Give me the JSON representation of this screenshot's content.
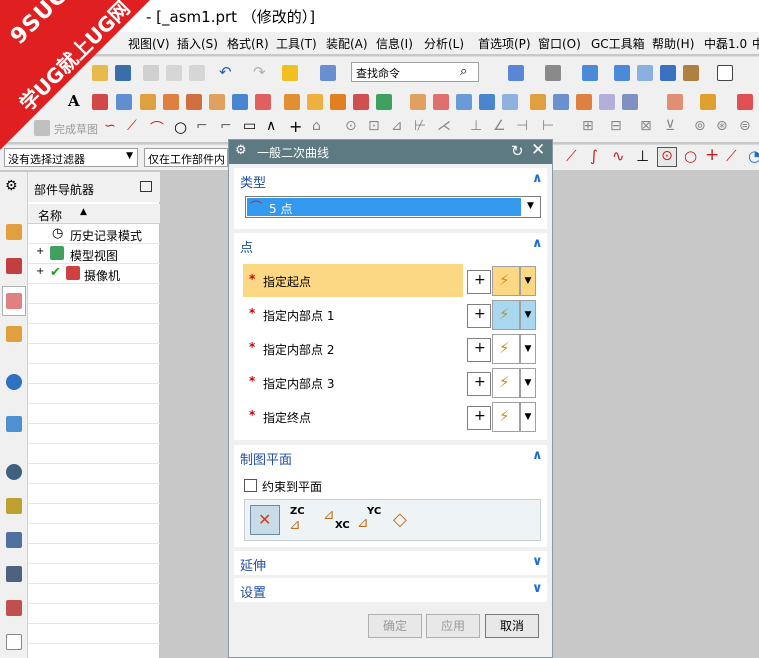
{
  "window": {
    "title": "- [_asm1.prt （修改的）]"
  },
  "watermark": {
    "line1": "9SUG",
    "line2": "学UG就上UG网"
  },
  "menu": [
    "视图(V)",
    "插入(S)",
    "格式(R)",
    "工具(T)",
    "装配(A)",
    "信息(I)",
    "分析(L)",
    "首选项(P)",
    "窗口(O)",
    "GC工具箱",
    "帮助(H)",
    "中磊1.0",
    "中"
  ],
  "toolbar": {
    "command_search_placeholder": "查找命令",
    "finish_sketch": "完成草图",
    "selection_filter": "没有选择过滤器",
    "scope_filter": "仅在工作部件内"
  },
  "navigator": {
    "title": "部件导航器",
    "column_name": "名称",
    "items": [
      {
        "label": "历史记录模式"
      },
      {
        "label": "模型视图"
      },
      {
        "label": "摄像机"
      }
    ]
  },
  "dialog": {
    "title": "一般二次曲线",
    "sections": {
      "type": {
        "header": "类型",
        "selected": "5 点"
      },
      "points": {
        "header": "点",
        "rows": [
          {
            "label": "指定起点"
          },
          {
            "label": "指定内部点 1"
          },
          {
            "label": "指定内部点 2"
          },
          {
            "label": "指定内部点 3"
          },
          {
            "label": "指定终点"
          }
        ]
      },
      "plane": {
        "header": "制图平面",
        "constrain_label": "约束到平面"
      },
      "extend": {
        "header": "延伸"
      },
      "settings": {
        "header": "设置"
      }
    },
    "buttons": {
      "ok": "确定",
      "apply": "应用",
      "cancel": "取消"
    }
  },
  "colors": {
    "dialog_title": "#5d7a82",
    "highlight": "#fcd884",
    "accent": "#1f6fd0",
    "watermark": "#e02020"
  }
}
